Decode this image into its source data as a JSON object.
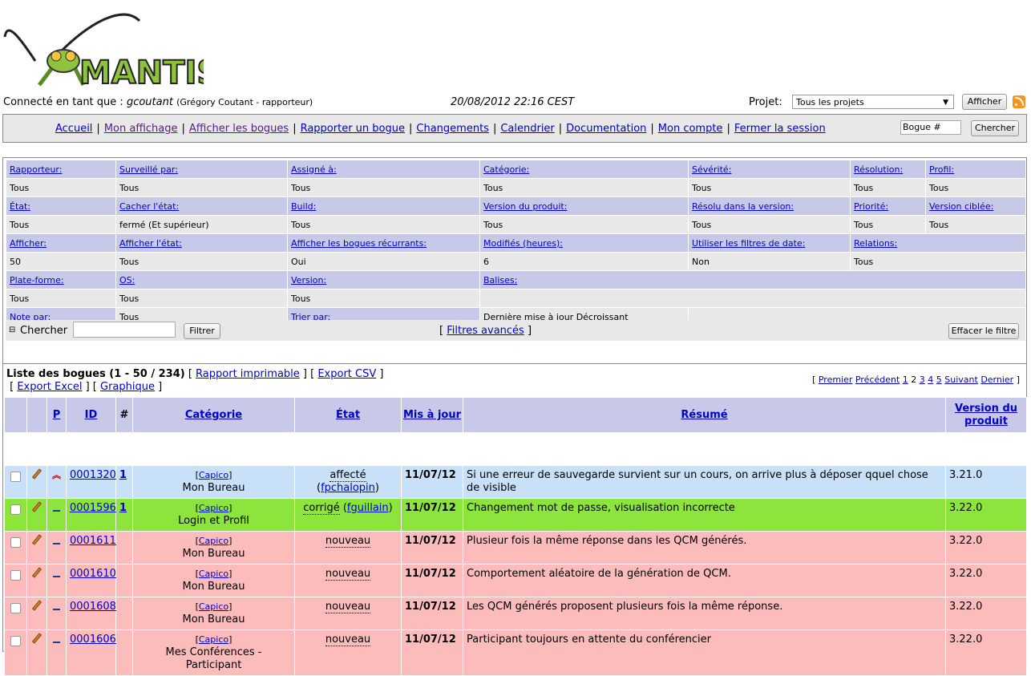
{
  "header": {
    "logo_text": "MANTIS",
    "login_prefix": "Connecté en tant que :",
    "username": "gcoutant",
    "user_detail": "(Grégory Coutant - rapporteur)",
    "datetime": "20/08/2012 22:16 CEST",
    "project_label": "Projet:",
    "project_value": "Tous les projets",
    "project_button": "Afficher"
  },
  "menu": {
    "items": [
      "Accueil",
      "Mon affichage",
      "Afficher les bogues",
      "Rapporter un bogue",
      "Changements",
      "Calendrier",
      "Documentation",
      "Mon compte",
      "Fermer la session"
    ],
    "bug_input_value": "Bogue #",
    "search_button": "Chercher"
  },
  "filters": {
    "rows": [
      {
        "headers": [
          "Rapporteur:",
          "Surveillé par:",
          "Assigné à:",
          "Catégorie:",
          "Sévérité:",
          "Résolution:",
          "Profil:"
        ],
        "values": [
          "Tous",
          "Tous",
          "Tous",
          "Tous",
          "Tous",
          "Tous",
          "Tous"
        ]
      },
      {
        "headers": [
          "État:",
          "Cacher l'état:",
          "Build:",
          "Version du produit:",
          "Résolu dans la version:",
          "Priorité:",
          "Version ciblée:"
        ],
        "values": [
          "Tous",
          "fermé (Et supérieur)",
          "Tous",
          "Tous",
          "Tous",
          "Tous",
          "Tous"
        ]
      },
      {
        "headers": [
          "Afficher:",
          "Afficher l'état:",
          "Afficher les bogues récurrants:",
          "Modifiés (heures):",
          "Utiliser les filtres de date:",
          "Relations:",
          ""
        ],
        "values": [
          "50",
          "Tous",
          "Oui",
          "6",
          "Non",
          "Tous",
          ""
        ]
      },
      {
        "headers": [
          "Plate-forme:",
          "OS:",
          "Version:",
          "Balises:",
          "",
          "",
          ""
        ],
        "values": [
          "Tous",
          "Tous",
          "Tous",
          "",
          "",
          "",
          ""
        ]
      },
      {
        "headers": [
          "Note par:",
          "Tous",
          "Trier par:",
          "Dernière mise à jour Décroissant",
          "",
          "",
          ""
        ]
      }
    ],
    "search_label": "Chercher",
    "filter_button": "Filtrer",
    "advanced_link": "Filtres avancés",
    "clear_button": "Effacer le filtre"
  },
  "buglist": {
    "title": "Liste des bogues (1 - 50 / 234)",
    "link_print": "Rapport imprimable",
    "link_csv": "Export CSV",
    "link_excel": "Export Excel",
    "link_graph": "Graphique",
    "pager": {
      "first": "Premier",
      "prev": "Précédent",
      "pages": [
        "1",
        "2",
        "3",
        "4",
        "5"
      ],
      "current": "2",
      "next": "Suivant",
      "last": "Dernier"
    },
    "columns": [
      "P",
      "ID",
      "#",
      "Catégorie",
      "État",
      "Mis à jour",
      "Résumé",
      "Version du produit"
    ],
    "rows": [
      {
        "color": "#c8e0f8",
        "priority": "high",
        "id": "0001320",
        "notes": "1",
        "project": "[Capico]",
        "category": "Mon Bureau",
        "status": "affecté",
        "handler": "fpchalopin",
        "updated": "11/07/12",
        "summary": "Si une erreur de sauvegarde survient sur un cours, on arrive plus à déposer qquel chose de visible",
        "version": "3.21.0"
      },
      {
        "color": "#8ce43c",
        "priority": "normal",
        "id": "0001596",
        "notes": "1",
        "project": "[Capico]",
        "category": "Login et Profil",
        "status": "corrigé",
        "handler": "fguillain",
        "updated": "11/07/12",
        "summary": "Changement mot de passe, visualisation incorrecte",
        "version": "3.22.0"
      },
      {
        "color": "#fcbcbc",
        "priority": "normal",
        "id": "0001611",
        "notes": "",
        "project": "[Capico]",
        "category": "Mon Bureau",
        "status": "nouveau",
        "handler": "",
        "updated": "11/07/12",
        "summary": "Plusieur fois la même réponse dans les QCM générés.",
        "version": "3.22.0"
      },
      {
        "color": "#fcbcbc",
        "priority": "normal",
        "id": "0001610",
        "notes": "",
        "project": "[Capico]",
        "category": "Mon Bureau",
        "status": "nouveau",
        "handler": "",
        "updated": "11/07/12",
        "summary": "Comportement aléatoire de la génération de QCM.",
        "version": "3.22.0"
      },
      {
        "color": "#fcbcbc",
        "priority": "normal",
        "id": "0001608",
        "notes": "",
        "project": "[Capico]",
        "category": "Mon Bureau",
        "status": "nouveau",
        "handler": "",
        "updated": "11/07/12",
        "summary": "Les QCM générés proposent plusieurs fois la même réponse.",
        "version": "3.22.0"
      },
      {
        "color": "#fcbcbc",
        "priority": "normal",
        "id": "0001606",
        "notes": "",
        "project": "[Capico]",
        "category": "Mes Conférences - Participant",
        "status": "nouveau",
        "handler": "",
        "updated": "11/07/12",
        "summary": "Participant toujours en attente du conférencier",
        "version": "3.22.0"
      }
    ]
  }
}
